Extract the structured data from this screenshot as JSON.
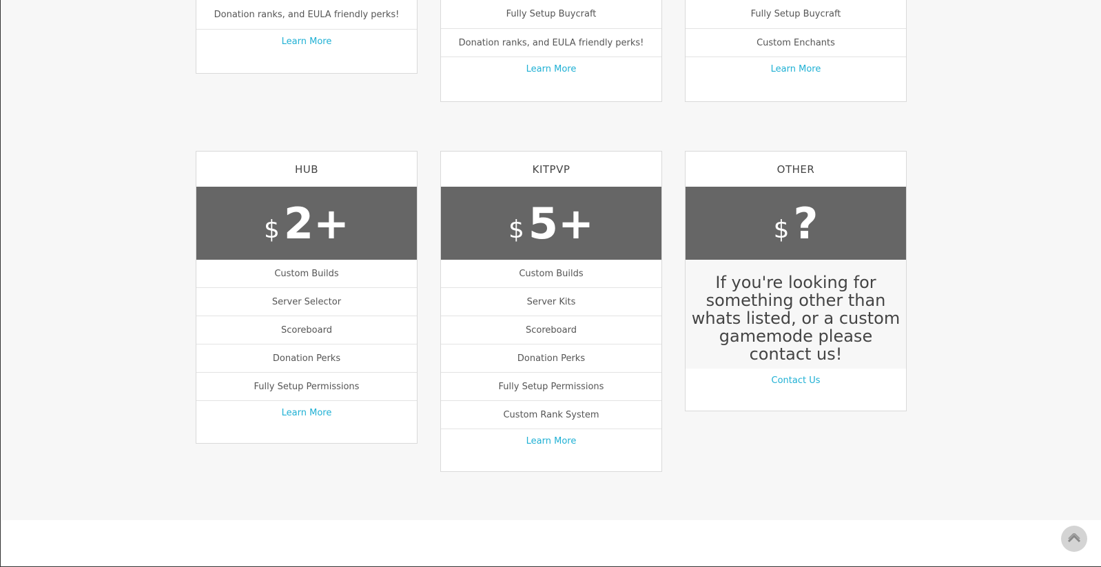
{
  "top_cards": [
    {
      "features": [
        "Donation ranks, and EULA friendly perks!"
      ],
      "link_label": "Learn More"
    },
    {
      "features": [
        "Fully Setup Buycraft",
        "Donation ranks, and EULA friendly perks!"
      ],
      "link_label": "Learn More"
    },
    {
      "features": [
        "Fully Setup Buycraft",
        "Custom Enchants"
      ],
      "link_label": "Learn More"
    }
  ],
  "cards": [
    {
      "title": "HUB",
      "currency": "$",
      "price": "2+",
      "features": [
        "Custom Builds",
        "Server Selector",
        "Scoreboard",
        "Donation Perks",
        "Fully Setup Permissions"
      ],
      "link_label": "Learn More"
    },
    {
      "title": "KITPVP",
      "currency": "$",
      "price": "5+",
      "features": [
        "Custom Builds",
        "Server Kits",
        "Scoreboard",
        "Donation Perks",
        "Fully Setup Permissions",
        "Custom Rank System"
      ],
      "link_label": "Learn More"
    },
    {
      "title": "OTHER",
      "currency": "$",
      "price": "?",
      "note": "If you're looking for something other than whats listed, or a custom gamemode please contact us!",
      "link_label": "Contact Us"
    }
  ],
  "scroll_top_icon": "chevron-up-icon",
  "colors": {
    "accent": "#1fb0d4",
    "price_band": "#666666",
    "background": "#f7f7f7"
  }
}
